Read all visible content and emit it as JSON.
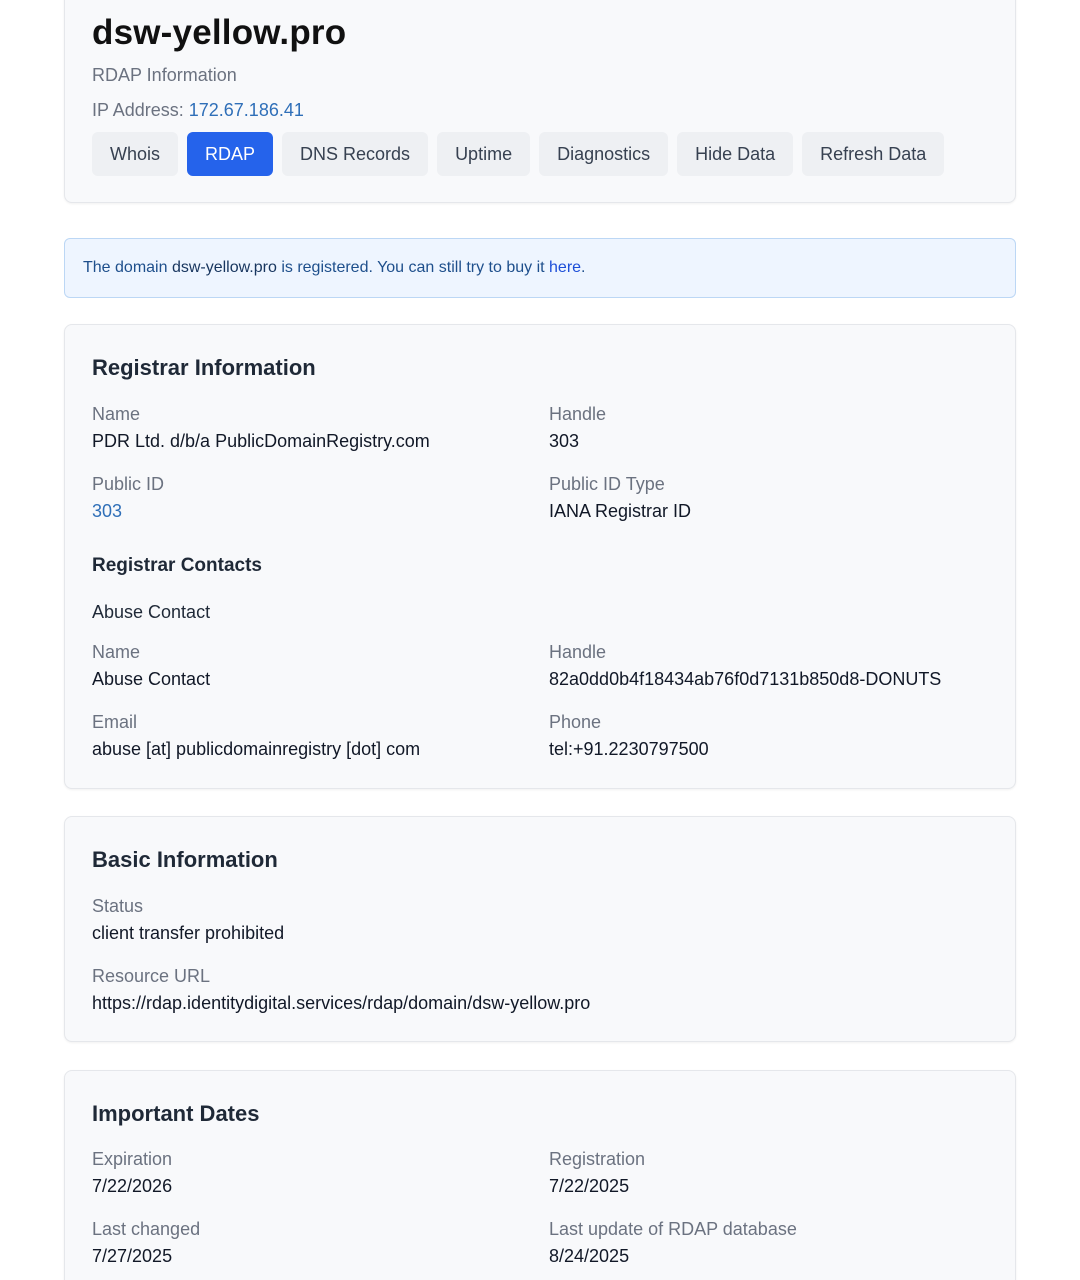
{
  "header": {
    "domain": "dsw-yellow.pro",
    "subtitle": "RDAP Information",
    "ip_label": "IP Address:",
    "ip_value": "172.67.186.41",
    "tabs": [
      {
        "label": "Whois",
        "active": false
      },
      {
        "label": "RDAP",
        "active": true
      },
      {
        "label": "DNS Records",
        "active": false
      },
      {
        "label": "Uptime",
        "active": false
      },
      {
        "label": "Diagnostics",
        "active": false
      },
      {
        "label": "Hide Data",
        "active": false
      },
      {
        "label": "Refresh Data",
        "active": false
      }
    ]
  },
  "alert": {
    "prefix": "The domain ",
    "domain": "dsw-yellow.pro",
    "middle": " is registered. You can still try to buy it ",
    "link": "here",
    "suffix": "."
  },
  "registrar": {
    "title": "Registrar Information",
    "name_label": "Name",
    "name_value": "PDR Ltd. d/b/a PublicDomainRegistry.com",
    "handle_label": "Handle",
    "handle_value": "303",
    "public_id_label": "Public ID",
    "public_id_value": "303",
    "public_id_type_label": "Public ID Type",
    "public_id_type_value": "IANA Registrar ID",
    "contacts_title": "Registrar Contacts",
    "abuse_title": "Abuse Contact",
    "contact_name_label": "Name",
    "contact_name_value": "Abuse Contact",
    "contact_handle_label": "Handle",
    "contact_handle_value": "82a0dd0b4f18434ab76f0d7131b850d8-DONUTS",
    "email_label": "Email",
    "email_value": "abuse [at] publicdomainregistry [dot] com",
    "phone_label": "Phone",
    "phone_value": "tel:+91.2230797500"
  },
  "basic": {
    "title": "Basic Information",
    "status_label": "Status",
    "status_value": "client transfer prohibited",
    "url_label": "Resource URL",
    "url_value": "https://rdap.identitydigital.services/rdap/domain/dsw-yellow.pro"
  },
  "dates": {
    "title": "Important Dates",
    "expiration_label": "Expiration",
    "expiration_value": "7/22/2026",
    "registration_label": "Registration",
    "registration_value": "7/22/2025",
    "last_changed_label": "Last changed",
    "last_changed_value": "7/27/2025",
    "rdap_update_label": "Last update of RDAP database",
    "rdap_update_value": "8/24/2025"
  }
}
